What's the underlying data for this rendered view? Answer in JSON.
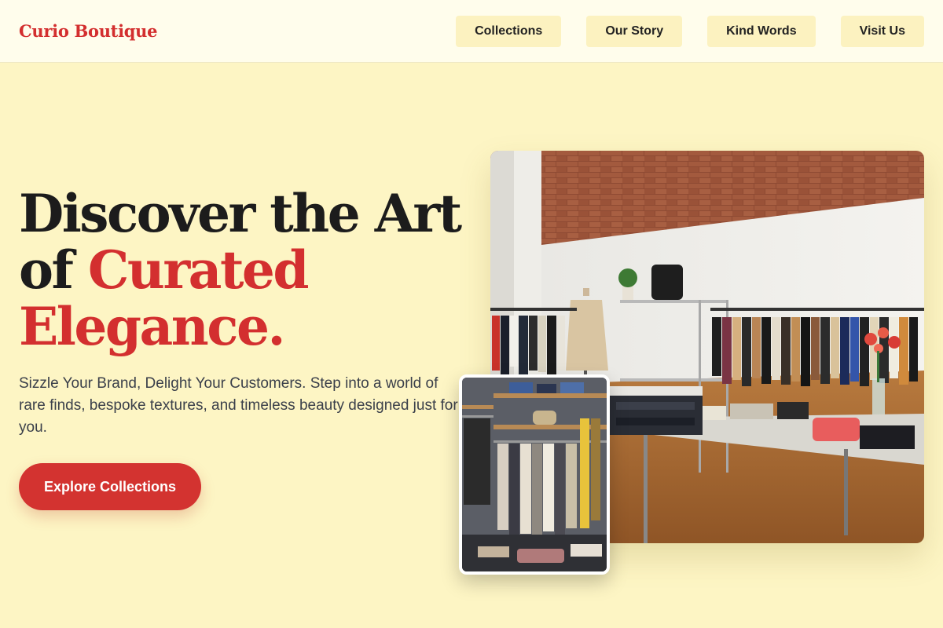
{
  "header": {
    "logo": "Curio Boutique",
    "nav": [
      {
        "label": "Collections"
      },
      {
        "label": "Our Story"
      },
      {
        "label": "Kind Words"
      },
      {
        "label": "Visit Us"
      }
    ]
  },
  "hero": {
    "title_line1": "Discover the Art",
    "title_of": "of ",
    "title_accent_1": "Curated",
    "title_accent_2": "Elegance.",
    "subtitle": "Sizzle Your Brand, Delight Your Customers. Step into a world of rare finds, bespoke textures, and timeless beauty designed just for you.",
    "cta_label": "Explore Collections"
  },
  "images": {
    "main": "boutique-interior-photo",
    "inset": "clothing-rack-photo"
  },
  "colors": {
    "accent": "#d32f2f",
    "background": "#fdf5c4",
    "header_background": "#fffdec",
    "nav_button": "#fcf2c0"
  }
}
